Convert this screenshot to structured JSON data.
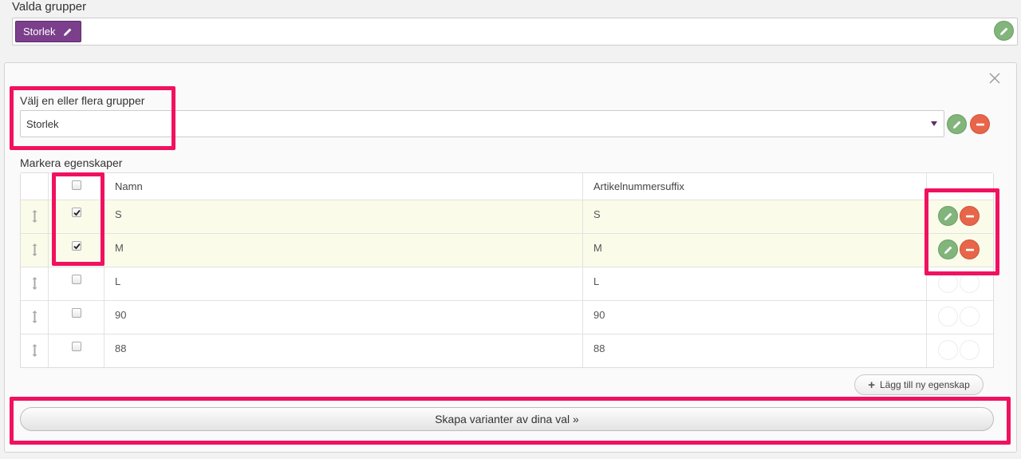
{
  "selected_groups": {
    "label": "Valda grupper",
    "tags": [
      {
        "label": "Storlek",
        "icon": "pencil-icon"
      }
    ],
    "edit_icon": "pencil-icon"
  },
  "panel": {
    "close_icon": "close-icon",
    "group_select": {
      "label": "Välj en eller flera grupper",
      "value": "Storlek",
      "caret_icon": "caret-down-icon"
    },
    "properties": {
      "label": "Markera egenskaper",
      "columns": [
        "Namn",
        "Artikelnummersuffix"
      ],
      "rows": [
        {
          "name": "S",
          "suffix": "S",
          "checked": true
        },
        {
          "name": "M",
          "suffix": "M",
          "checked": true
        },
        {
          "name": "L",
          "suffix": "L",
          "checked": false
        },
        {
          "name": "90",
          "suffix": "90",
          "checked": false
        },
        {
          "name": "88",
          "suffix": "88",
          "checked": false
        }
      ]
    },
    "add_property_label": "Lägg till ny egenskap",
    "create_variants_label": "Skapa varianter av dina val »"
  },
  "colors": {
    "tag_purple": "#7b3f8c",
    "edit_green": "#82b57c",
    "delete_red": "#e7664a",
    "highlight_row": "#fbfbea",
    "annotation_pink": "#f0115f"
  }
}
